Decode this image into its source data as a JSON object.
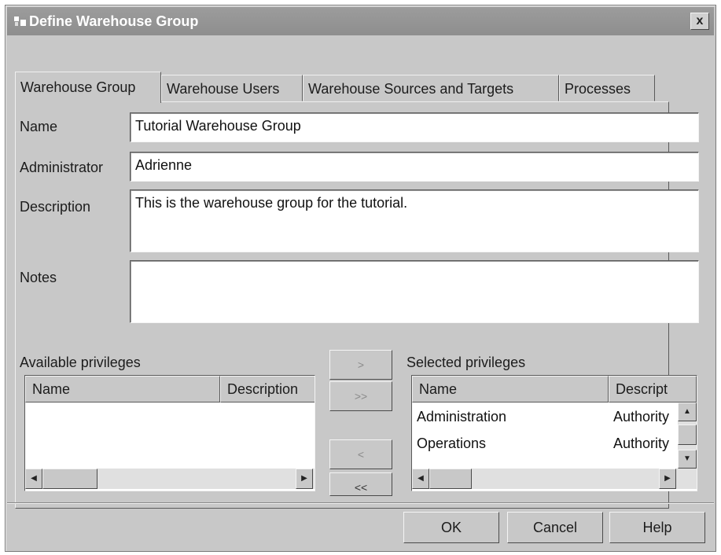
{
  "window": {
    "title": "Define Warehouse Group",
    "close_label": "x"
  },
  "tabs": [
    {
      "label": "Warehouse Group"
    },
    {
      "label": "Warehouse Users"
    },
    {
      "label": "Warehouse Sources and Targets"
    },
    {
      "label": "Processes"
    }
  ],
  "form": {
    "name_label": "Name",
    "name_value": "Tutorial Warehouse Group",
    "administrator_label": "Administrator",
    "administrator_value": "Adrienne",
    "description_label": "Description",
    "description_value": "This is the warehouse group for the tutorial.",
    "notes_label": "Notes",
    "notes_value": ""
  },
  "available": {
    "title": "Available privileges",
    "columns": [
      "Name",
      "Description"
    ],
    "rows": []
  },
  "selected": {
    "title": "Selected privileges",
    "columns": [
      "Name",
      "Descript"
    ],
    "rows": [
      {
        "name": "Administration",
        "desc": "Authority"
      },
      {
        "name": "Operations",
        "desc": "Authority"
      }
    ]
  },
  "move_buttons": {
    "add": ">",
    "add_all": ">>",
    "remove": "<",
    "remove_all": "<<"
  },
  "buttons": {
    "ok": "OK",
    "cancel": "Cancel",
    "help": "Help"
  }
}
